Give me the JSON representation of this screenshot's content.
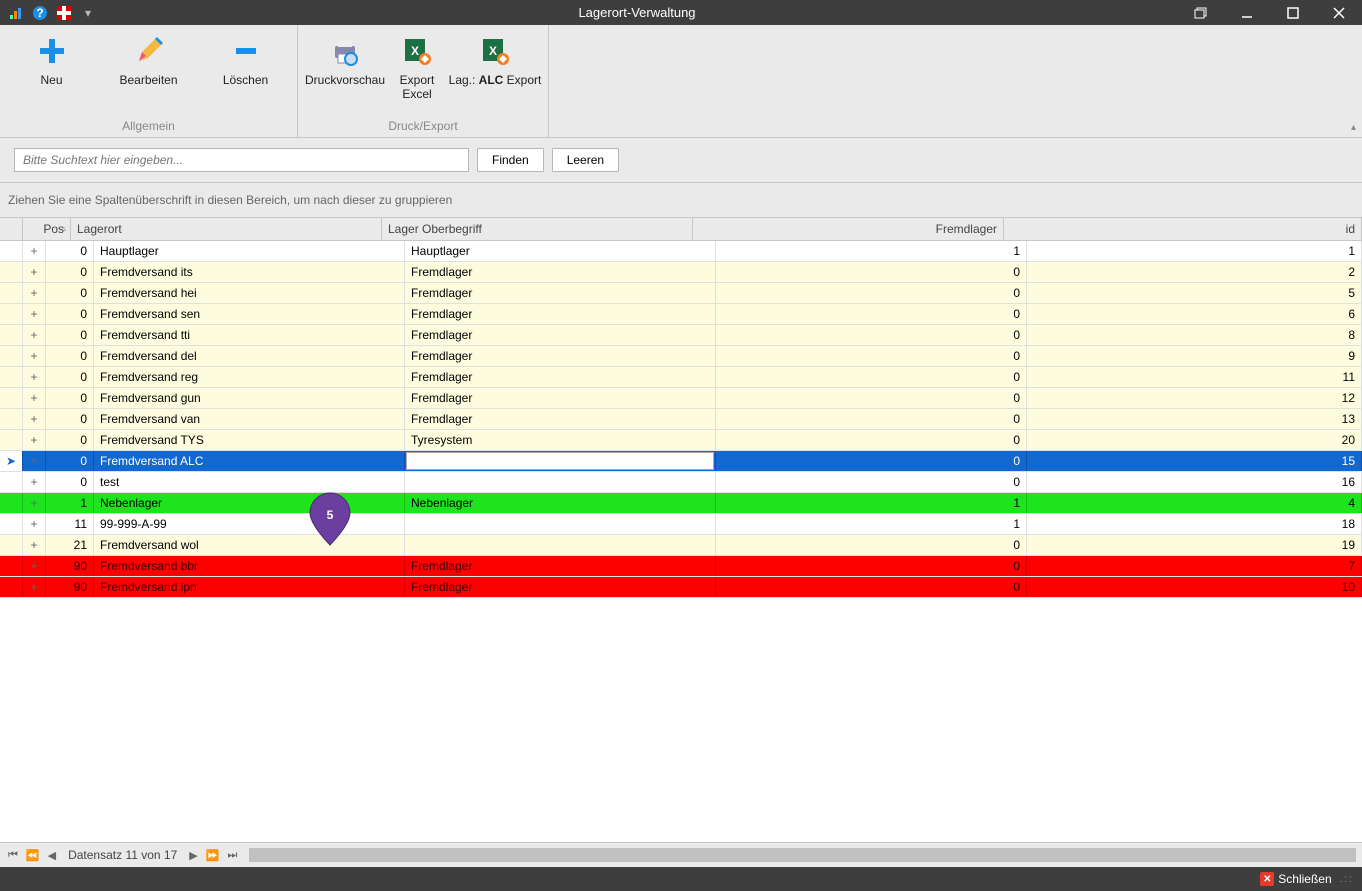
{
  "window": {
    "title": "Lagerort-Verwaltung"
  },
  "ribbon": {
    "groups": [
      {
        "name": "Allgemein",
        "items": [
          {
            "name": "neu",
            "label": "Neu",
            "icon": "plus"
          },
          {
            "name": "bearbeiten",
            "label": "Bearbeiten",
            "icon": "pencil"
          },
          {
            "name": "loeschen",
            "label": "Löschen",
            "icon": "minus"
          }
        ]
      },
      {
        "name": "Druck/Export",
        "items": [
          {
            "name": "druckvorschau",
            "label": "Druckvorschau",
            "icon": "print"
          },
          {
            "name": "export-excel",
            "label": "Export\nExcel",
            "icon": "excel"
          },
          {
            "name": "lag-alc-export",
            "label_html": "Lag.: <b>ALC</b> Export",
            "label": "Lag.: ALC Export",
            "icon": "excel"
          }
        ]
      }
    ]
  },
  "search": {
    "placeholder": "Bitte Suchtext hier eingeben...",
    "find_label": "Finden",
    "clear_label": "Leeren"
  },
  "group_hint": "Ziehen Sie eine Spaltenüberschrift in diesen Bereich, um nach dieser zu gruppieren",
  "columns": {
    "pos": "Pos",
    "lagerort": "Lagerort",
    "oberbegriff": "Lager Oberbegriff",
    "fremdlager": "Fremdlager",
    "id": "id"
  },
  "rows": [
    {
      "pos": 0,
      "lagerort": "Hauptlager",
      "ober": "Hauptlager",
      "fremd": 1,
      "id": 1,
      "style": "white"
    },
    {
      "pos": 0,
      "lagerort": "Fremdversand its",
      "ober": "Fremdlager",
      "fremd": 0,
      "id": 2,
      "style": "cream"
    },
    {
      "pos": 0,
      "lagerort": "Fremdversand hei",
      "ober": "Fremdlager",
      "fremd": 0,
      "id": 5,
      "style": "cream"
    },
    {
      "pos": 0,
      "lagerort": "Fremdversand sen",
      "ober": "Fremdlager",
      "fremd": 0,
      "id": 6,
      "style": "cream"
    },
    {
      "pos": 0,
      "lagerort": "Fremdversand tti",
      "ober": "Fremdlager",
      "fremd": 0,
      "id": 8,
      "style": "cream"
    },
    {
      "pos": 0,
      "lagerort": "Fremdversand del",
      "ober": "Fremdlager",
      "fremd": 0,
      "id": 9,
      "style": "cream"
    },
    {
      "pos": 0,
      "lagerort": "Fremdversand reg",
      "ober": "Fremdlager",
      "fremd": 0,
      "id": 11,
      "style": "cream"
    },
    {
      "pos": 0,
      "lagerort": "Fremdversand gun",
      "ober": "Fremdlager",
      "fremd": 0,
      "id": 12,
      "style": "cream"
    },
    {
      "pos": 0,
      "lagerort": "Fremdversand van",
      "ober": "Fremdlager",
      "fremd": 0,
      "id": 13,
      "style": "cream"
    },
    {
      "pos": 0,
      "lagerort": "Fremdversand TYS",
      "ober": "Tyresystem",
      "fremd": 0,
      "id": 20,
      "style": "cream"
    },
    {
      "pos": 0,
      "lagerort": "Fremdversand ALC",
      "ober": "",
      "fremd": 0,
      "id": 15,
      "style": "selected",
      "editing": true
    },
    {
      "pos": 0,
      "lagerort": "test",
      "ober": "",
      "fremd": 0,
      "id": 16,
      "style": "white"
    },
    {
      "pos": 1,
      "lagerort": "Nebenlager",
      "ober": "Nebenlager",
      "fremd": 1,
      "id": 4,
      "style": "green"
    },
    {
      "pos": 11,
      "lagerort": "99-999-A-99",
      "ober": "",
      "fremd": 1,
      "id": 18,
      "style": "white"
    },
    {
      "pos": 21,
      "lagerort": "Fremdversand wol",
      "ober": "",
      "fremd": 0,
      "id": 19,
      "style": "cream"
    },
    {
      "pos": 90,
      "lagerort": "Fremdversand bbr",
      "ober": "Fremdlager",
      "fremd": 0,
      "id": 7,
      "style": "red"
    },
    {
      "pos": 90,
      "lagerort": "Fremdversand ipn",
      "ober": "Fremdlager",
      "fremd": 0,
      "id": 10,
      "style": "red"
    }
  ],
  "pager": {
    "record_text": "Datensatz 11 von 17"
  },
  "marker": {
    "number": "5"
  },
  "footer": {
    "close_label": "Schließen"
  }
}
